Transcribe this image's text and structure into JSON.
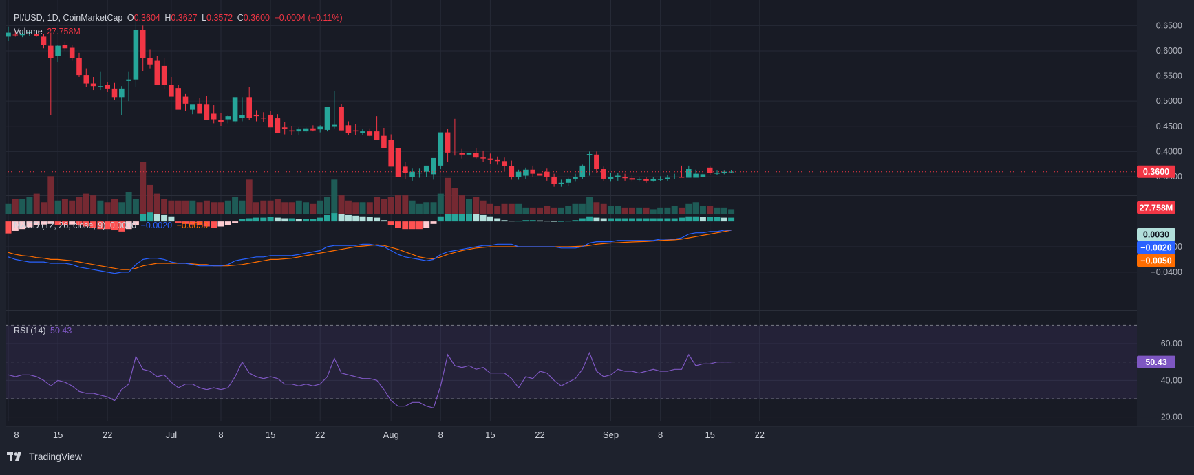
{
  "header": {
    "symbol": "PI/USD, 1D, CoinMarketCap",
    "o_label": "O",
    "o_value": "0.3604",
    "h_label": "H",
    "h_value": "0.3627",
    "l_label": "L",
    "l_value": "0.3572",
    "c_label": "C",
    "c_value": "0.3600",
    "change": "−0.0004 (−0.11%)",
    "volume_label": "Volume",
    "volume_value": "27.758M"
  },
  "macd_legend": {
    "label": "MACD (12, 26, close, 9)",
    "hist": "0.0030",
    "macd": "−0.0020",
    "signal": "−0.0050"
  },
  "rsi_legend": {
    "label": "RSI (14)",
    "value": "50.43"
  },
  "price_axis": [
    "0.6500",
    "0.6000",
    "0.5500",
    "0.5000",
    "0.4500",
    "0.4000",
    "0.3500"
  ],
  "macd_axis": [
    "−0.0200",
    "−0.0400"
  ],
  "rsi_axis": [
    "60.00",
    "40.00",
    "20.00"
  ],
  "x_axis": [
    "8",
    "15",
    "22",
    "Jul",
    "8",
    "15",
    "22",
    "Aug",
    "8",
    "15",
    "22",
    "Sep",
    "8",
    "15",
    "22"
  ],
  "badges": {
    "price": "0.3600",
    "volume": "27.758M",
    "hist": "0.0030",
    "macd": "−0.0020",
    "signal": "−0.0050",
    "rsi": "50.43"
  },
  "brand": {
    "name": "TradingView"
  },
  "colors": {
    "up": "#26a69a",
    "down": "#f23645",
    "macd": "#2962ff",
    "signal": "#ff6d00",
    "rsi": "#7e57c2",
    "bg": "#1e222d"
  },
  "chart_data": [
    {
      "type": "candlestick",
      "title": "PI/USD, 1D, CoinMarketCap",
      "x": [
        "Jun 8",
        "Jun 9",
        "Jun 10",
        "Jun 11",
        "Jun 12",
        "Jun 13",
        "Jun 14",
        "Jun 15",
        "Jun 16",
        "Jun 17",
        "Jun 18",
        "Jun 19",
        "Jun 20",
        "Jun 21",
        "Jun 22",
        "Jun 23",
        "Jun 24",
        "Jun 25",
        "Jun 26",
        "Jun 27",
        "Jun 28",
        "Jun 29",
        "Jun 30",
        "Jul 1",
        "Jul 2",
        "Jul 3",
        "Jul 4",
        "Jul 5",
        "Jul 6",
        "Jul 7",
        "Jul 8",
        "Jul 9",
        "Jul 10",
        "Jul 11",
        "Jul 12",
        "Jul 13",
        "Jul 14",
        "Jul 15",
        "Jul 16",
        "Jul 17",
        "Jul 18",
        "Jul 19",
        "Jul 20",
        "Jul 21",
        "Jul 22",
        "Jul 23",
        "Jul 24",
        "Jul 25",
        "Jul 26",
        "Jul 27",
        "Jul 28",
        "Jul 29",
        "Jul 30",
        "Jul 31",
        "Aug 1",
        "Aug 2",
        "Aug 3",
        "Aug 4",
        "Aug 5",
        "Aug 6",
        "Aug 7",
        "Aug 8",
        "Aug 9",
        "Aug 10",
        "Aug 11",
        "Aug 12",
        "Aug 13",
        "Aug 14",
        "Aug 15",
        "Aug 16",
        "Aug 17",
        "Aug 18",
        "Aug 19",
        "Aug 20",
        "Aug 21",
        "Aug 22",
        "Aug 23",
        "Aug 24",
        "Aug 25",
        "Aug 26",
        "Aug 27",
        "Aug 28",
        "Aug 29",
        "Aug 30",
        "Aug 31",
        "Sep 1",
        "Sep 2",
        "Sep 3",
        "Sep 4",
        "Sep 5",
        "Sep 6",
        "Sep 7",
        "Sep 8",
        "Sep 9",
        "Sep 10",
        "Sep 11",
        "Sep 12",
        "Sep 13",
        "Sep 14",
        "Sep 15",
        "Sep 16",
        "Sep 17",
        "Sep 18"
      ],
      "open": [
        0.628,
        0.632,
        0.631,
        0.636,
        0.634,
        0.628,
        0.61,
        0.59,
        0.612,
        0.606,
        0.585,
        0.552,
        0.535,
        0.53,
        0.533,
        0.525,
        0.508,
        0.54,
        0.543,
        0.642,
        0.585,
        0.58,
        0.57,
        0.532,
        0.526,
        0.509,
        0.483,
        0.495,
        0.493,
        0.475,
        0.462,
        0.464,
        0.46,
        0.467,
        0.508,
        0.473,
        0.467,
        0.473,
        0.466,
        0.448,
        0.442,
        0.44,
        0.44,
        0.446,
        0.444,
        0.443,
        0.449,
        0.488,
        0.452,
        0.442,
        0.437,
        0.44,
        0.44,
        0.431,
        0.423,
        0.407,
        0.37,
        0.35,
        0.358,
        0.36,
        0.355,
        0.372,
        0.438,
        0.398,
        0.397,
        0.394,
        0.397,
        0.388,
        0.386,
        0.383,
        0.381,
        0.371,
        0.35,
        0.352,
        0.364,
        0.356,
        0.36,
        0.349,
        0.336,
        0.338,
        0.346,
        0.35,
        0.395,
        0.394,
        0.365,
        0.346,
        0.349,
        0.35,
        0.347,
        0.344,
        0.345,
        0.342,
        0.345,
        0.345,
        0.35,
        0.35,
        0.348,
        0.348,
        0.35,
        0.368,
        0.356,
        0.358,
        0.36
      ],
      "high": [
        0.648,
        0.64,
        0.639,
        0.642,
        0.64,
        0.634,
        0.636,
        0.612,
        0.618,
        0.612,
        0.596,
        0.565,
        0.548,
        0.558,
        0.538,
        0.536,
        0.53,
        0.558,
        0.658,
        0.65,
        0.602,
        0.59,
        0.585,
        0.548,
        0.532,
        0.514,
        0.492,
        0.506,
        0.51,
        0.492,
        0.476,
        0.472,
        0.472,
        0.508,
        0.528,
        0.482,
        0.478,
        0.48,
        0.474,
        0.458,
        0.45,
        0.448,
        0.448,
        0.452,
        0.452,
        0.456,
        0.52,
        0.494,
        0.46,
        0.454,
        0.445,
        0.446,
        0.47,
        0.447,
        0.434,
        0.412,
        0.38,
        0.366,
        0.366,
        0.368,
        0.37,
        0.39,
        0.445,
        0.465,
        0.405,
        0.402,
        0.406,
        0.402,
        0.396,
        0.39,
        0.388,
        0.382,
        0.364,
        0.368,
        0.372,
        0.368,
        0.366,
        0.356,
        0.344,
        0.348,
        0.356,
        0.374,
        0.4,
        0.4,
        0.37,
        0.358,
        0.358,
        0.356,
        0.354,
        0.35,
        0.35,
        0.35,
        0.351,
        0.353,
        0.356,
        0.372,
        0.372,
        0.364,
        0.358,
        0.372,
        0.362,
        0.362,
        0.363
      ],
      "low": [
        0.62,
        0.628,
        0.627,
        0.63,
        0.628,
        0.605,
        0.472,
        0.578,
        0.6,
        0.58,
        0.548,
        0.528,
        0.522,
        0.522,
        0.518,
        0.502,
        0.472,
        0.5,
        0.528,
        0.56,
        0.565,
        0.56,
        0.525,
        0.52,
        0.5,
        0.48,
        0.474,
        0.478,
        0.482,
        0.456,
        0.45,
        0.456,
        0.456,
        0.46,
        0.462,
        0.46,
        0.458,
        0.464,
        0.44,
        0.434,
        0.432,
        0.432,
        0.436,
        0.44,
        0.438,
        0.44,
        0.446,
        0.442,
        0.432,
        0.432,
        0.432,
        0.43,
        0.428,
        0.415,
        0.4,
        0.36,
        0.346,
        0.342,
        0.348,
        0.35,
        0.344,
        0.365,
        0.38,
        0.392,
        0.386,
        0.382,
        0.386,
        0.38,
        0.376,
        0.374,
        0.36,
        0.344,
        0.344,
        0.346,
        0.35,
        0.35,
        0.342,
        0.33,
        0.33,
        0.332,
        0.34,
        0.346,
        0.352,
        0.358,
        0.342,
        0.34,
        0.342,
        0.342,
        0.34,
        0.34,
        0.338,
        0.34,
        0.341,
        0.342,
        0.345,
        0.348,
        0.35,
        0.353,
        0.353,
        0.354,
        0.353,
        0.355,
        0.357
      ],
      "close": [
        0.636,
        0.631,
        0.634,
        0.637,
        0.63,
        0.612,
        0.585,
        0.61,
        0.605,
        0.585,
        0.552,
        0.535,
        0.53,
        0.53,
        0.525,
        0.508,
        0.525,
        0.543,
        0.642,
        0.585,
        0.573,
        0.532,
        0.533,
        0.509,
        0.483,
        0.495,
        0.493,
        0.475,
        0.462,
        0.464,
        0.458,
        0.47,
        0.508,
        0.472,
        0.467,
        0.47,
        0.466,
        0.448,
        0.437,
        0.445,
        0.44,
        0.444,
        0.446,
        0.442,
        0.449,
        0.488,
        0.453,
        0.442,
        0.437,
        0.44,
        0.44,
        0.431,
        0.423,
        0.407,
        0.37,
        0.35,
        0.358,
        0.36,
        0.358,
        0.372,
        0.387,
        0.438,
        0.398,
        0.397,
        0.394,
        0.397,
        0.388,
        0.386,
        0.383,
        0.381,
        0.371,
        0.35,
        0.36,
        0.364,
        0.356,
        0.352,
        0.349,
        0.336,
        0.338,
        0.346,
        0.35,
        0.372,
        0.395,
        0.365,
        0.346,
        0.349,
        0.352,
        0.347,
        0.344,
        0.345,
        0.342,
        0.345,
        0.345,
        0.348,
        0.35,
        0.348,
        0.365,
        0.356,
        0.355,
        0.358,
        0.358,
        0.36,
        0.36
      ],
      "volume": [
        6,
        9,
        9,
        10,
        12,
        7,
        22,
        8,
        9,
        8,
        10,
        12,
        11,
        8,
        7,
        9,
        7,
        13,
        9,
        30,
        17,
        12,
        9,
        8,
        8,
        8,
        8,
        7,
        8,
        7,
        7,
        8,
        10,
        8,
        20,
        7,
        8,
        8,
        9,
        7,
        7,
        8,
        7,
        6,
        8,
        10,
        20,
        11,
        8,
        7,
        7,
        7,
        10,
        9,
        10,
        11,
        11,
        8,
        6,
        7,
        7,
        12,
        21,
        15,
        11,
        9,
        10,
        8,
        6,
        5,
        6,
        6,
        6,
        4,
        4,
        4,
        5,
        4,
        4,
        5,
        6,
        6,
        10,
        7,
        6,
        5,
        5,
        4,
        4,
        4,
        4,
        3,
        4,
        4,
        5,
        4,
        6,
        7,
        5,
        5,
        4,
        4,
        3
      ],
      "last_price": 0.36,
      "ylim": [
        0.335,
        0.66
      ]
    },
    {
      "type": "histogram+line",
      "title": "MACD (12, 26, close, 9)",
      "x_ref": "same as price",
      "histogram": [
        -0.0095,
        -0.0075,
        -0.006,
        -0.0045,
        -0.003,
        -0.0025,
        -0.002,
        -0.003,
        -0.003,
        -0.0025,
        -0.003,
        -0.004,
        -0.005,
        -0.006,
        -0.006,
        -0.007,
        -0.008,
        -0.006,
        -0.003,
        0.006,
        0.007,
        0.006,
        0.005,
        0.004,
        -0.001,
        -0.002,
        -0.0025,
        -0.003,
        -0.004,
        -0.005,
        -0.004,
        -0.003,
        -0.001,
        0.002,
        0.0025,
        0.003,
        0.003,
        0.0035,
        0.003,
        0.0025,
        0.0025,
        0.002,
        0.002,
        0.002,
        0.003,
        0.005,
        0.0065,
        0.0055,
        0.005,
        0.0045,
        0.004,
        0.0035,
        0.003,
        0.001,
        -0.003,
        -0.005,
        -0.006,
        -0.006,
        -0.006,
        -0.005,
        -0.002,
        0.004,
        0.0055,
        0.006,
        0.006,
        0.006,
        0.0055,
        0.005,
        0.004,
        0.0025,
        0.001,
        0.0005,
        0.0005,
        0.001,
        0.001,
        0.0008,
        0.0005,
        0.0003,
        0.0003,
        0.0005,
        0.001,
        0.0025,
        0.004,
        0.003,
        0.0025,
        0.0025,
        0.0025,
        0.0025,
        0.0025,
        0.0025,
        0.0025,
        0.0025,
        0.0025,
        0.0025,
        0.0025,
        0.003,
        0.004,
        0.004,
        0.0035,
        0.0035,
        0.0035,
        0.003,
        0.003
      ],
      "macd": [
        -0.028,
        -0.03,
        -0.031,
        -0.032,
        -0.032,
        -0.032,
        -0.033,
        -0.033,
        -0.033,
        -0.034,
        -0.036,
        -0.037,
        -0.038,
        -0.039,
        -0.04,
        -0.041,
        -0.04,
        -0.04,
        -0.034,
        -0.03,
        -0.029,
        -0.029,
        -0.03,
        -0.032,
        -0.033,
        -0.033,
        -0.034,
        -0.035,
        -0.035,
        -0.035,
        -0.035,
        -0.034,
        -0.031,
        -0.03,
        -0.029,
        -0.028,
        -0.028,
        -0.027,
        -0.027,
        -0.027,
        -0.027,
        -0.026,
        -0.025,
        -0.024,
        -0.023,
        -0.02,
        -0.019,
        -0.019,
        -0.019,
        -0.019,
        -0.018,
        -0.018,
        -0.019,
        -0.02,
        -0.023,
        -0.026,
        -0.028,
        -0.029,
        -0.03,
        -0.031,
        -0.03,
        -0.026,
        -0.024,
        -0.023,
        -0.022,
        -0.021,
        -0.02,
        -0.019,
        -0.019,
        -0.018,
        -0.018,
        -0.018,
        -0.02,
        -0.02,
        -0.02,
        -0.02,
        -0.02,
        -0.02,
        -0.021,
        -0.021,
        -0.021,
        -0.02,
        -0.017,
        -0.016,
        -0.016,
        -0.016,
        -0.015,
        -0.015,
        -0.015,
        -0.015,
        -0.015,
        -0.015,
        -0.014,
        -0.014,
        -0.014,
        -0.013,
        -0.01,
        -0.009,
        -0.009,
        -0.008,
        -0.008,
        -0.007,
        -0.007
      ],
      "signal": [
        -0.0245,
        -0.026,
        -0.027,
        -0.0275,
        -0.0285,
        -0.029,
        -0.03,
        -0.03,
        -0.0305,
        -0.031,
        -0.032,
        -0.033,
        -0.034,
        -0.035,
        -0.036,
        -0.037,
        -0.038,
        -0.038,
        -0.037,
        -0.035,
        -0.034,
        -0.033,
        -0.033,
        -0.033,
        -0.033,
        -0.033,
        -0.0335,
        -0.034,
        -0.034,
        -0.035,
        -0.035,
        -0.035,
        -0.0345,
        -0.034,
        -0.033,
        -0.032,
        -0.031,
        -0.03,
        -0.03,
        -0.0295,
        -0.029,
        -0.028,
        -0.027,
        -0.026,
        -0.025,
        -0.024,
        -0.023,
        -0.022,
        -0.021,
        -0.02,
        -0.0195,
        -0.019,
        -0.0185,
        -0.019,
        -0.0205,
        -0.022,
        -0.024,
        -0.026,
        -0.028,
        -0.029,
        -0.0295,
        -0.028,
        -0.026,
        -0.0245,
        -0.023,
        -0.022,
        -0.021,
        -0.0205,
        -0.02,
        -0.02,
        -0.02,
        -0.02,
        -0.02,
        -0.02,
        -0.02,
        -0.02,
        -0.02,
        -0.02,
        -0.02,
        -0.02,
        -0.0198,
        -0.0195,
        -0.019,
        -0.018,
        -0.0175,
        -0.017,
        -0.0168,
        -0.0165,
        -0.0162,
        -0.016,
        -0.0158,
        -0.0155,
        -0.015,
        -0.0148,
        -0.0145,
        -0.014,
        -0.013,
        -0.012,
        -0.011,
        -0.01,
        -0.009,
        -0.008,
        -0.007
      ],
      "ylim": [
        -0.052,
        0.012
      ]
    },
    {
      "type": "line",
      "title": "RSI (14)",
      "x_ref": "same as price",
      "values": [
        43,
        42,
        43,
        43,
        42,
        40,
        37,
        40,
        39,
        37,
        34,
        33,
        33,
        32,
        31,
        29,
        35,
        38,
        53,
        46,
        45,
        42,
        43,
        39,
        36,
        38,
        38,
        36,
        35,
        36,
        35,
        36,
        42,
        50,
        44,
        42,
        41,
        42,
        41,
        38,
        38,
        37,
        38,
        37,
        38,
        42,
        52,
        44,
        43,
        42,
        41,
        41,
        40,
        35,
        29,
        26,
        26,
        28,
        28,
        26,
        25,
        37,
        54,
        48,
        47,
        48,
        46,
        47,
        44,
        44,
        44,
        41,
        36,
        42,
        41,
        45,
        44,
        40,
        37,
        39,
        41,
        46,
        55,
        45,
        42,
        43,
        46,
        45,
        45,
        44,
        45,
        46,
        45,
        45,
        46,
        46,
        54,
        48,
        49,
        49,
        50,
        50,
        50
      ],
      "overbought": 70,
      "middle": 50,
      "oversold": 30,
      "ylim": [
        18,
        72
      ]
    }
  ]
}
